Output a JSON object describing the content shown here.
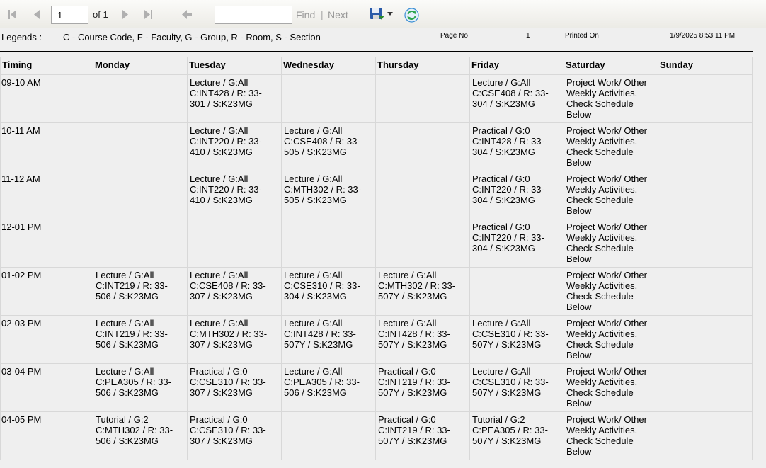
{
  "toolbar": {
    "page_value": "1",
    "of_text": "of 1",
    "find_label": "Find",
    "separator": "|",
    "next_label": "Next",
    "find_value": "",
    "icons": [
      "first-page-icon",
      "previous-page-icon",
      "next-page-icon",
      "last-page-icon",
      "back-icon",
      "save-icon",
      "dropdown-arrow-icon",
      "refresh-icon"
    ]
  },
  "legend": {
    "label": "Legends :",
    "text": "C - Course Code, F - Faculty, G - Group, R - Room, S - Section",
    "page_no_label": "Page No",
    "page_no_value": "1",
    "printed_on_label": "Printed On",
    "printed_on_value": "1/9/2025 8:53:11 PM"
  },
  "timetable": {
    "headers": [
      "Timing",
      "Monday",
      "Tuesday",
      "Wednesday",
      "Thursday",
      "Friday",
      "Saturday",
      "Sunday"
    ],
    "rows": [
      {
        "timing": "09-10 AM",
        "cells": [
          "",
          " Lecture / G:All\nC:INT428 / R: 33-\n301 / S:K23MG",
          "",
          "",
          " Lecture / G:All\nC:CSE408 / R: 33-\n304 / S:K23MG",
          "Project Work/ Other Weekly Activities. Check Schedule Below",
          ""
        ]
      },
      {
        "timing": "10-11 AM",
        "cells": [
          "",
          " Lecture / G:All\nC:INT220 / R: 33-\n410 / S:K23MG",
          " Lecture / G:All\nC:CSE408 / R: 33-\n505 / S:K23MG",
          "",
          " Practical / G:0\nC:INT428 / R: 33-\n304 / S:K23MG",
          "Project Work/ Other Weekly Activities. Check Schedule Below",
          ""
        ]
      },
      {
        "timing": "11-12 AM",
        "cells": [
          "",
          " Lecture / G:All\nC:INT220 / R: 33-\n410 / S:K23MG",
          " Lecture / G:All\nC:MTH302 / R: 33-\n505 / S:K23MG",
          "",
          " Practical / G:0\nC:INT220 / R: 33-\n304 / S:K23MG",
          "Project Work/ Other Weekly Activities. Check Schedule Below",
          ""
        ]
      },
      {
        "timing": "12-01 PM",
        "cells": [
          "",
          "",
          "",
          "",
          " Practical / G:0\nC:INT220 / R: 33-\n304 / S:K23MG",
          "Project Work/ Other Weekly Activities. Check Schedule Below",
          ""
        ]
      },
      {
        "timing": "01-02 PM",
        "cells": [
          " Lecture / G:All\nC:INT219 / R: 33-\n506 / S:K23MG",
          " Lecture / G:All\nC:CSE408 / R: 33-\n307 / S:K23MG",
          " Lecture / G:All\nC:CSE310 / R: 33-\n304 / S:K23MG",
          " Lecture / G:All\nC:MTH302 / R: 33-\n507Y / S:K23MG",
          "",
          "Project Work/ Other Weekly Activities. Check Schedule Below",
          ""
        ]
      },
      {
        "timing": "02-03 PM",
        "cells": [
          " Lecture / G:All\nC:INT219 / R: 33-\n506 / S:K23MG",
          " Lecture / G:All\nC:MTH302 / R: 33-\n307 / S:K23MG",
          " Lecture / G:All\nC:INT428 / R: 33-\n507Y / S:K23MG",
          " Lecture / G:All\nC:INT428 / R: 33-\n507Y / S:K23MG",
          " Lecture / G:All\nC:CSE310 / R: 33-\n507Y / S:K23MG",
          "Project Work/ Other Weekly Activities. Check Schedule Below",
          ""
        ]
      },
      {
        "timing": "03-04 PM",
        "cells": [
          " Lecture / G:All\nC:PEA305 / R: 33-\n506 / S:K23MG",
          " Practical / G:0\nC:CSE310 / R: 33-\n307 / S:K23MG",
          " Lecture / G:All\nC:PEA305 / R: 33-\n506 / S:K23MG",
          " Practical / G:0\nC:INT219 / R: 33-\n507Y / S:K23MG",
          " Lecture / G:All\nC:CSE310 / R: 33-\n507Y / S:K23MG",
          "Project Work/ Other Weekly Activities. Check Schedule Below",
          ""
        ]
      },
      {
        "timing": "04-05 PM",
        "cells": [
          " Tutorial / G:2\nC:MTH302 / R: 33-\n506 / S:K23MG",
          " Practical / G:0\nC:CSE310 / R: 33-\n307 / S:K23MG",
          "",
          " Practical / G:0\nC:INT219 / R: 33-\n507Y / S:K23MG",
          " Tutorial / G:2\nC:PEA305 / R: 33-\n507Y / S:K23MG",
          "Project Work/ Other Weekly Activities. Check Schedule Below",
          ""
        ]
      }
    ]
  }
}
